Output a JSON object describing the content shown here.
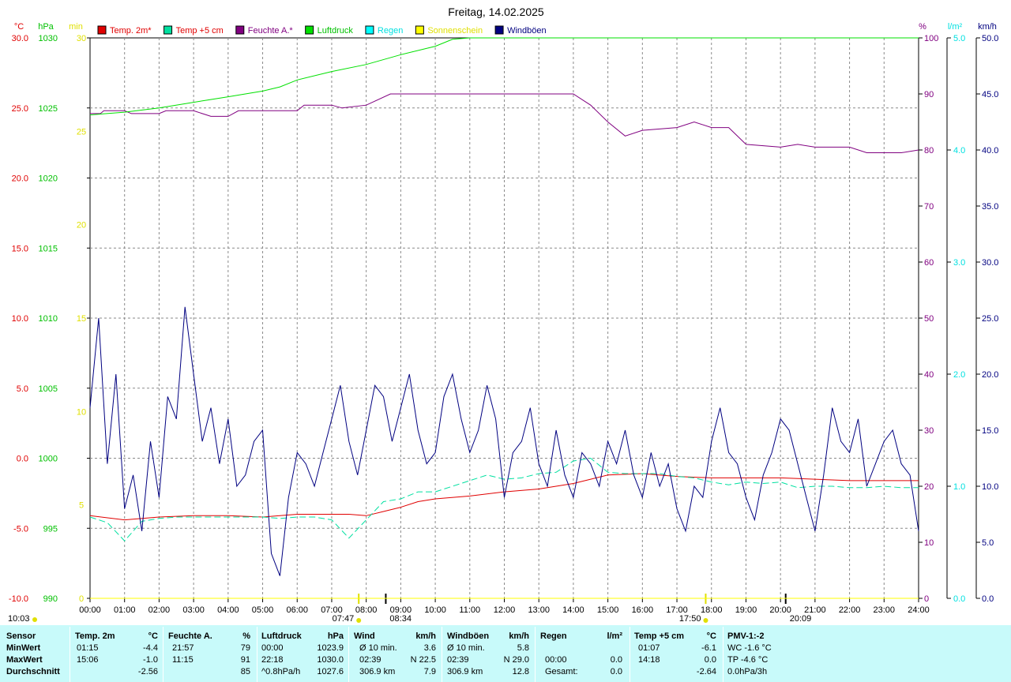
{
  "title": "Freitag, 14.02.2025",
  "legend": [
    {
      "label": "Temp. 2m*",
      "color": "#e00000",
      "text_color": "#e00000"
    },
    {
      "label": "Temp +5 cm",
      "color": "#00e0a0",
      "text_color": "#e00000"
    },
    {
      "label": "Feuchte A.*",
      "color": "#800080",
      "text_color": "#800080"
    },
    {
      "label": "Luftdruck",
      "color": "#00e000",
      "text_color": "#00c000"
    },
    {
      "label": "Regen",
      "color": "#00ffff",
      "text_color": "#00e0e0"
    },
    {
      "label": "Sonnenschein",
      "color": "#ffff00",
      "text_color": "#e0e000"
    },
    {
      "label": "Windböen",
      "color": "#000080",
      "text_color": "#000080"
    }
  ],
  "axis_units": {
    "temp": "°C",
    "pressure": "hPa",
    "sun": "min",
    "humidity": "%",
    "rain": "l/m²",
    "wind": "km/h"
  },
  "sun_times": {
    "date_stamp": "10:03",
    "sunrise": "07:47",
    "noon": "08:34",
    "sunset": "17:50",
    "moonrise": "20:09"
  },
  "chart_data": {
    "type": "line",
    "x_range": [
      "00:00",
      "24:00"
    ],
    "x_ticks": [
      "00:00",
      "01:00",
      "02:00",
      "03:00",
      "04:00",
      "05:00",
      "06:00",
      "07:00",
      "08:00",
      "09:00",
      "10:00",
      "11:00",
      "12:00",
      "13:00",
      "14:00",
      "15:00",
      "16:00",
      "17:00",
      "18:00",
      "19:00",
      "20:00",
      "21:00",
      "22:00",
      "23:00",
      "24:00"
    ],
    "axes": {
      "temp": {
        "range": [
          -10,
          30
        ],
        "ticks": [
          "30.0",
          "25.0",
          "20.0",
          "15.0",
          "10.0",
          "5.0",
          "0.0",
          "-5.0",
          "-10.0"
        ]
      },
      "pressure": {
        "range": [
          990,
          1030
        ],
        "ticks": [
          "1030",
          "1025",
          "1020",
          "1015",
          "1010",
          "1005",
          "1000",
          "995",
          "990"
        ]
      },
      "sun": {
        "range": [
          0,
          30
        ],
        "ticks": [
          "30",
          "25",
          "20",
          "15",
          "10",
          "5",
          "0"
        ]
      },
      "humidity": {
        "range": [
          0,
          100
        ],
        "ticks": [
          "100",
          "90",
          "80",
          "70",
          "60",
          "50",
          "40",
          "30",
          "20",
          "10",
          "0"
        ]
      },
      "rain": {
        "range": [
          0,
          5
        ],
        "ticks": [
          "5.0",
          "4.0",
          "3.0",
          "2.0",
          "1.0",
          "0.0"
        ]
      },
      "wind": {
        "range": [
          0,
          50
        ],
        "ticks": [
          "50.0",
          "45.0",
          "40.0",
          "35.0",
          "30.0",
          "25.0",
          "20.0",
          "15.0",
          "10.0",
          "5.0",
          "0.0"
        ]
      }
    },
    "series": [
      {
        "name": "Temp. 2m*",
        "axis": "temp",
        "color": "#e00000",
        "x": [
          0,
          1,
          2,
          3,
          4,
          5,
          6,
          7,
          7.5,
          8,
          8.5,
          9,
          9.5,
          10,
          11,
          12,
          13,
          14,
          14.5,
          15,
          16,
          17,
          18,
          19,
          20,
          21,
          22,
          23,
          24
        ],
        "y": [
          -4.1,
          -4.4,
          -4.2,
          -4.1,
          -4.1,
          -4.2,
          -4.0,
          -4.0,
          -4.0,
          -4.1,
          -3.8,
          -3.5,
          -3.1,
          -2.9,
          -2.7,
          -2.4,
          -2.2,
          -1.8,
          -1.5,
          -1.2,
          -1.1,
          -1.3,
          -1.4,
          -1.4,
          -1.4,
          -1.5,
          -1.6,
          -1.6,
          -1.6
        ]
      },
      {
        "name": "Temp +5 cm",
        "axis": "temp",
        "color": "#00e0a0",
        "x": [
          0,
          0.5,
          1,
          1.5,
          2,
          2.5,
          3,
          3.5,
          4,
          4.5,
          5,
          5.5,
          6,
          6.5,
          7,
          7.5,
          8,
          8.5,
          9,
          9.5,
          10,
          10.5,
          11,
          11.5,
          12,
          12.5,
          13,
          13.5,
          14,
          14.5,
          15,
          15.5,
          16,
          16.5,
          17,
          17.5,
          18,
          18.5,
          19,
          19.5,
          20,
          20.5,
          21,
          21.5,
          22,
          22.5,
          23,
          23.5,
          24
        ],
        "y": [
          -4.2,
          -4.6,
          -5.9,
          -4.5,
          -4.3,
          -4.2,
          -4.2,
          -4.2,
          -4.2,
          -4.2,
          -4.2,
          -4.3,
          -4.2,
          -4.2,
          -4.4,
          -5.7,
          -4.4,
          -3.1,
          -2.9,
          -2.4,
          -2.4,
          -2.0,
          -1.6,
          -1.2,
          -1.5,
          -1.4,
          -1.1,
          -1.0,
          -0.2,
          0.0,
          -1.0,
          -1.1,
          -1.1,
          -1.1,
          -1.3,
          -1.4,
          -1.7,
          -1.9,
          -1.7,
          -1.8,
          -1.7,
          -2.1,
          -2.0,
          -2.0,
          -2.1,
          -2.1,
          -2.0,
          -2.1,
          -2.1
        ]
      },
      {
        "name": "Feuchte A.*",
        "axis": "humidity",
        "color": "#800080",
        "x": [
          0,
          0.3,
          0.4,
          1,
          1.2,
          2,
          2.2,
          3,
          3.5,
          4,
          4.3,
          5,
          6,
          6.2,
          7,
          7.3,
          8,
          8.7,
          9,
          9.5,
          10,
          11,
          12,
          13,
          14,
          14.5,
          15,
          15.5,
          16,
          17,
          17.5,
          18,
          18.5,
          19,
          20,
          20.5,
          21,
          22,
          22.5,
          23,
          23.5,
          24
        ],
        "y": [
          86.5,
          86.5,
          87,
          87,
          86.5,
          86.5,
          87,
          87,
          86,
          86,
          87,
          87,
          87,
          88,
          88,
          87.5,
          88,
          90,
          90,
          90,
          90,
          90,
          90,
          90,
          90,
          88,
          85,
          82.5,
          83.5,
          84,
          85,
          84,
          84,
          81,
          80.5,
          81,
          80.5,
          80.5,
          79.5,
          79.5,
          79.5,
          80
        ]
      },
      {
        "name": "Luftdruck",
        "axis": "pressure",
        "color": "#00e000",
        "x": [
          0,
          1,
          2,
          3,
          4,
          5,
          5.5,
          6,
          7,
          8,
          9,
          10,
          10.5,
          11,
          11.5,
          12,
          13,
          14,
          15,
          16,
          17,
          18,
          19,
          20,
          21,
          22,
          23,
          24
        ],
        "y": [
          1024.5,
          1024.7,
          1025.0,
          1025.4,
          1025.8,
          1026.2,
          1026.5,
          1027.0,
          1027.6,
          1028.1,
          1028.8,
          1029.4,
          1029.9,
          1030.4,
          1030.8,
          1031.4,
          1031.6,
          1031.6,
          1031.4,
          1031.2,
          1031.0,
          1031.5,
          1032.0,
          1032.6,
          1032.9,
          1033.3,
          1033.2,
          1032.5
        ]
      },
      {
        "name": "Regen",
        "axis": "rain",
        "color": "#00ffff",
        "x": [
          0,
          24
        ],
        "y": [
          0,
          0
        ]
      },
      {
        "name": "Sonnenschein",
        "axis": "sun",
        "color": "#ffff00",
        "x": [
          0,
          24
        ],
        "y": [
          0,
          0
        ]
      },
      {
        "name": "Windböen",
        "axis": "wind",
        "color": "#000080",
        "x": [
          0,
          0.25,
          0.5,
          0.75,
          1,
          1.25,
          1.5,
          1.75,
          2,
          2.25,
          2.5,
          2.75,
          3,
          3.25,
          3.5,
          3.75,
          4,
          4.25,
          4.5,
          4.75,
          5,
          5.25,
          5.5,
          5.75,
          6,
          6.25,
          6.5,
          6.75,
          7,
          7.25,
          7.5,
          7.75,
          8,
          8.25,
          8.5,
          8.75,
          9,
          9.25,
          9.5,
          9.75,
          10,
          10.25,
          10.5,
          10.75,
          11,
          11.25,
          11.5,
          11.75,
          12,
          12.25,
          12.5,
          12.75,
          13,
          13.25,
          13.5,
          13.75,
          14,
          14.25,
          14.5,
          14.75,
          15,
          15.25,
          15.5,
          15.75,
          16,
          16.25,
          16.5,
          16.75,
          17,
          17.25,
          17.5,
          17.75,
          18,
          18.25,
          18.5,
          18.75,
          19,
          19.25,
          19.5,
          19.75,
          20,
          20.25,
          20.5,
          20.75,
          21,
          21.25,
          21.5,
          21.75,
          22,
          22.25,
          22.5,
          22.75,
          23,
          23.25,
          23.5,
          23.75,
          24
        ],
        "y": [
          17,
          25,
          12,
          20,
          8,
          11,
          6,
          14,
          9,
          18,
          16,
          26,
          20,
          14,
          17,
          12,
          16,
          10,
          11,
          14,
          15,
          4,
          2,
          9,
          13,
          12,
          10,
          13,
          16,
          19,
          14,
          11,
          15,
          19,
          18,
          14,
          17,
          20,
          15,
          12,
          13,
          18,
          20,
          16,
          13,
          15,
          19,
          16,
          9,
          13,
          14,
          17,
          12,
          10,
          15,
          11,
          9,
          13,
          12,
          10,
          14,
          12,
          15,
          11,
          9,
          13,
          10,
          12,
          8,
          6,
          10,
          9,
          14,
          17,
          13,
          12,
          9,
          7,
          11,
          13,
          16,
          15,
          12,
          9,
          6,
          11,
          17,
          14,
          13,
          16,
          10,
          12,
          14,
          15,
          12,
          11,
          6
        ]
      }
    ]
  },
  "table": {
    "sensor": {
      "head": "Sensor",
      "rows": [
        "MinWert",
        "MaxWert",
        "Durchschnitt"
      ]
    },
    "temp2m": {
      "head": "Temp. 2m",
      "unit": "°C",
      "rows": [
        [
          "01:15",
          "-4.4"
        ],
        [
          "15:06",
          "-1.0"
        ],
        [
          "",
          "-2.56"
        ]
      ]
    },
    "humidity": {
      "head": "Feuchte A.",
      "unit": "%",
      "rows": [
        [
          "21:57",
          "79"
        ],
        [
          "11:15",
          "91"
        ],
        [
          "",
          "85"
        ]
      ]
    },
    "pressure": {
      "head": "Luftdruck",
      "unit": "hPa",
      "rows": [
        [
          "00:00",
          "1023.9"
        ],
        [
          "22:18",
          "1030.0"
        ],
        [
          "^0.8hPa/h",
          "1027.6"
        ]
      ]
    },
    "wind": {
      "head": "Wind",
      "unit": "km/h",
      "rows": [
        [
          "Ø 10 min.",
          "3.6"
        ],
        [
          "02:39",
          "N 22.5"
        ],
        [
          "306.9 km",
          "7.9"
        ]
      ]
    },
    "gusts": {
      "head": "Windböen",
      "unit": "km/h",
      "rows": [
        [
          "Ø 10 min.",
          "5.8"
        ],
        [
          "02:39",
          "N 29.0"
        ],
        [
          "306.9 km",
          "12.8"
        ]
      ]
    },
    "rain": {
      "head": "Regen",
      "unit": "l/m²",
      "rows": [
        [
          "",
          ""
        ],
        [
          "00:00",
          "0.0"
        ],
        [
          "Gesamt:",
          "0.0"
        ]
      ]
    },
    "temp5cm": {
      "head": "Temp +5 cm",
      "unit": "°C",
      "rows": [
        [
          "01:07",
          "-6.1"
        ],
        [
          "14:18",
          "0.0"
        ],
        [
          "",
          "-2.64"
        ]
      ]
    },
    "pmv": {
      "head": "PMV-1:-2",
      "rows": [
        "WC -1.6 °C",
        "TP -4.6 °C",
        "0.0hPa/3h"
      ]
    }
  }
}
